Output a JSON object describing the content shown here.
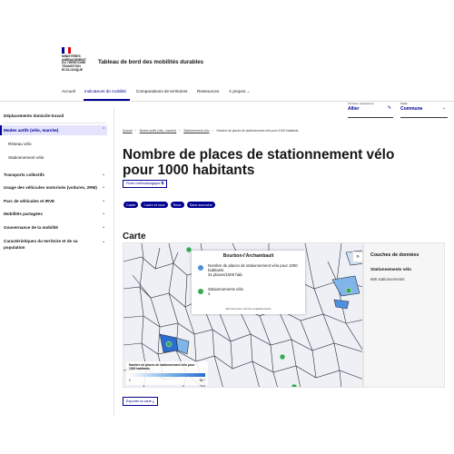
{
  "header": {
    "logo_lines": [
      "Ministères",
      "Aménagement",
      "du Territoire",
      "Transition",
      "Écologique"
    ],
    "service_title": "Tableau de bord des mobilités durables"
  },
  "nav": {
    "items": [
      "Accueil",
      "Indicateurs de mobilité",
      "Comparaisons de territoires",
      "Ressources",
      "À propos"
    ]
  },
  "selectors": {
    "territoire": {
      "label": "Territoire sélectionné",
      "value": "Allier"
    },
    "maille": {
      "label": "Maille",
      "value": "Commune"
    }
  },
  "sidebar": {
    "items": [
      {
        "label": "Déplacements domicile-travail"
      },
      {
        "label": "Modes actifs (vélo, marche)"
      },
      {
        "label": "Réseau vélo"
      },
      {
        "label": "Stationnement vélo"
      },
      {
        "label": "Transports collectifs"
      },
      {
        "label": "Usage des véhicules motorisés (voitures, 2RM)"
      },
      {
        "label": "Parc de véhicules et IRVE"
      },
      {
        "label": "Mobilités partagées"
      },
      {
        "label": "Gouvernance de la mobilité"
      },
      {
        "label": "Caractéristiques du territoire et de sa population"
      }
    ]
  },
  "breadcrumb": [
    "Accueil",
    "Modes actifs (vélo, marche)",
    "Stationnement vélo",
    "Nombre de places de stationnement vélo pour 1000 habitants"
  ],
  "page": {
    "title": "Nombre de places de stationnement vélo pour 1000 habitants",
    "fiche_label": "Fiche méthodologique",
    "tags": [
      "Cadre",
      "Cadre et roue",
      "Roue",
      "Sans accroche"
    ],
    "section": "Carte",
    "export_label": "Exporter la carte"
  },
  "map": {
    "popup": {
      "title": "Bourbon-l'Archambault",
      "row1_label": "Nombre de places de stationnement vélo pour 1000 habitants",
      "row1_value": "31 places/1000 hab.",
      "row2_label": "Stationnements vélo",
      "row2_value": "4",
      "note": "Zoomez pour voir les emplacements"
    },
    "legend": {
      "title": "Nombre de places de stationnement vélo pour 1000 habitants",
      "min": "0",
      "max": "58.7"
    },
    "toggle": "»"
  },
  "layers": {
    "title": "Couches de données",
    "item": "Stationnements vélo",
    "count": "686 stationnements"
  },
  "colors": {
    "primary": "#000091",
    "marker": "#36a852",
    "popup_blue": "#4f8fe0"
  }
}
